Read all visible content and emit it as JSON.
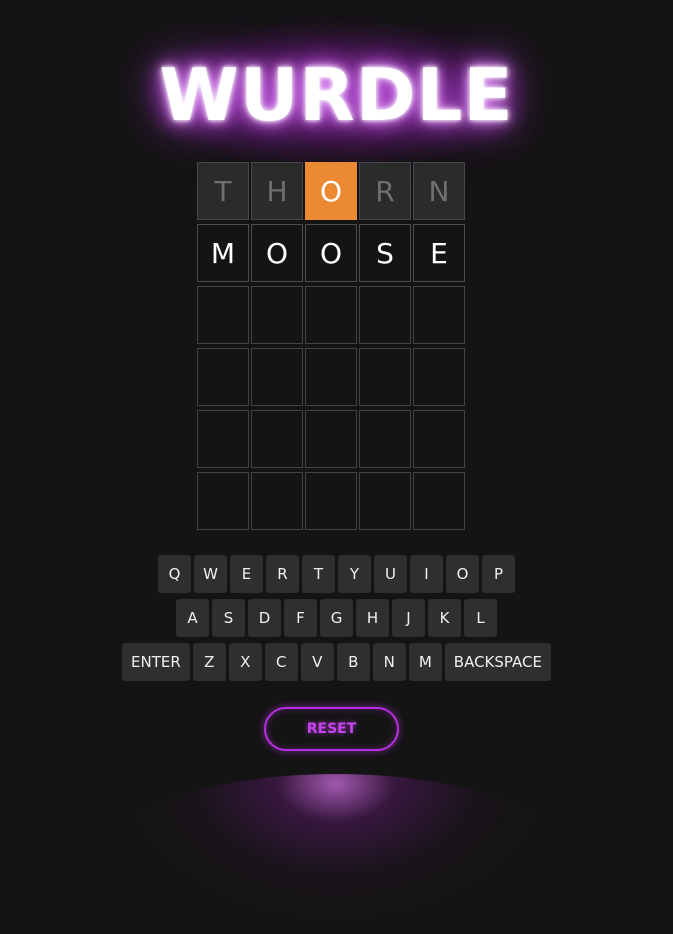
{
  "title": "WURDLE",
  "colors": {
    "background": "#141414",
    "present": "#ec8a33",
    "used_tile": "#2b2b2b",
    "key": "#2f2f2f",
    "neon": "#b62ee0"
  },
  "board": {
    "rows": [
      {
        "state": "submitted",
        "tiles": [
          {
            "letter": "T",
            "status": "absent"
          },
          {
            "letter": "H",
            "status": "absent"
          },
          {
            "letter": "O",
            "status": "present"
          },
          {
            "letter": "R",
            "status": "absent"
          },
          {
            "letter": "N",
            "status": "absent"
          }
        ]
      },
      {
        "state": "typed",
        "tiles": [
          {
            "letter": "M",
            "status": "typed"
          },
          {
            "letter": "O",
            "status": "typed"
          },
          {
            "letter": "O",
            "status": "typed"
          },
          {
            "letter": "S",
            "status": "typed"
          },
          {
            "letter": "E",
            "status": "typed"
          }
        ]
      },
      {
        "state": "empty",
        "tiles": [
          {
            "letter": ""
          },
          {
            "letter": ""
          },
          {
            "letter": ""
          },
          {
            "letter": ""
          },
          {
            "letter": ""
          }
        ]
      },
      {
        "state": "empty",
        "tiles": [
          {
            "letter": ""
          },
          {
            "letter": ""
          },
          {
            "letter": ""
          },
          {
            "letter": ""
          },
          {
            "letter": ""
          }
        ]
      },
      {
        "state": "empty",
        "tiles": [
          {
            "letter": ""
          },
          {
            "letter": ""
          },
          {
            "letter": ""
          },
          {
            "letter": ""
          },
          {
            "letter": ""
          }
        ]
      },
      {
        "state": "empty",
        "tiles": [
          {
            "letter": ""
          },
          {
            "letter": ""
          },
          {
            "letter": ""
          },
          {
            "letter": ""
          },
          {
            "letter": ""
          }
        ]
      }
    ]
  },
  "keyboard": {
    "rows": [
      [
        "Q",
        "W",
        "E",
        "R",
        "T",
        "Y",
        "U",
        "I",
        "O",
        "P"
      ],
      [
        "A",
        "S",
        "D",
        "F",
        "G",
        "H",
        "J",
        "K",
        "L"
      ],
      [
        "ENTER",
        "Z",
        "X",
        "C",
        "V",
        "B",
        "N",
        "M",
        "BACKSPACE"
      ]
    ]
  },
  "reset_label": "RESET"
}
